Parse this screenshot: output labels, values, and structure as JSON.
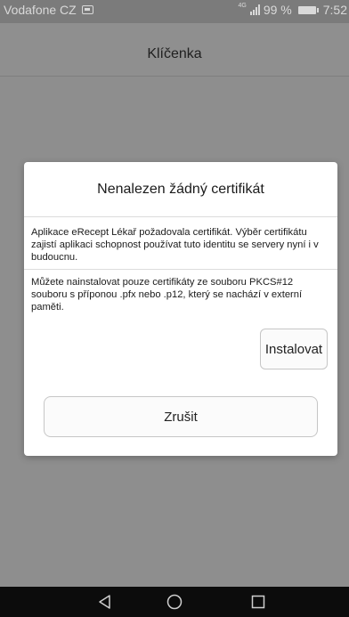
{
  "status_bar": {
    "carrier": "Vodafone CZ",
    "network": "4G",
    "battery": "99 %",
    "time": "7:52"
  },
  "app": {
    "title": "Klíčenka"
  },
  "dialog": {
    "title": "Nenalezen žádný certifikát",
    "paragraph1": "Aplikace eRecept Lékař požadovala certifikát. Výběr certifikátu zajistí aplikaci schopnost používat tuto identitu se servery nyní i v budoucnu.",
    "paragraph2": "Můžete nainstalovat pouze certifikáty ze souboru PKCS#12 souboru s příponou .pfx nebo .p12, který se nachází v externí paměti.",
    "install_label": "Instalovat",
    "cancel_label": "Zrušit"
  },
  "nav": {
    "icons": [
      "back-icon",
      "home-icon",
      "recents-icon"
    ]
  },
  "colors": {
    "scrim": "#8e8e8e",
    "dialog_bg": "#ffffff",
    "nav_bg": "#0c0c0c",
    "text": "#1b1b1b"
  }
}
